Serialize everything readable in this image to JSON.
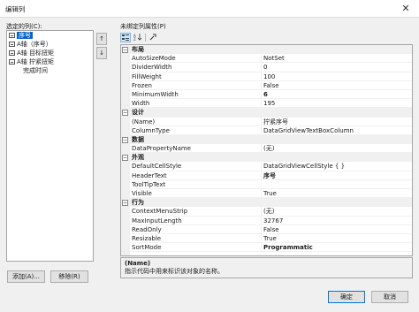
{
  "window": {
    "title": "编辑列",
    "close_glyph": "✕"
  },
  "left_panel": {
    "label": "选定的列(C):",
    "columns": [
      {
        "text": "序号",
        "selected": true,
        "icon": true
      },
      {
        "text": "A轴（序号）",
        "selected": false,
        "icon": true
      },
      {
        "text": "A轴 目标扭矩",
        "selected": false,
        "icon": true
      },
      {
        "text": "A轴 拧紧扭矩",
        "selected": false,
        "icon": true
      },
      {
        "text": "完成时间",
        "selected": false,
        "icon": false
      }
    ],
    "move_up_glyph": "↑",
    "move_down_glyph": "↓",
    "add_button": "添加(A)...",
    "remove_button": "移除(R)"
  },
  "right_panel": {
    "label": "未绑定列属性(P)",
    "toolbar": {
      "categorized_icon": "categorized-icon",
      "alphabetical_icon": "alphabetical-icon",
      "property_pages_icon": "property-pages-icon"
    },
    "rows": [
      {
        "type": "category",
        "name": "布局"
      },
      {
        "type": "property",
        "name": "AutoSizeMode",
        "value": "NotSet",
        "bold": false
      },
      {
        "type": "property",
        "name": "DividerWidth",
        "value": "0",
        "bold": false
      },
      {
        "type": "property",
        "name": "FillWeight",
        "value": "100",
        "bold": false
      },
      {
        "type": "property",
        "name": "Frozen",
        "value": "False",
        "bold": false
      },
      {
        "type": "property",
        "name": "MinimumWidth",
        "value": "6",
        "bold": true
      },
      {
        "type": "property",
        "name": "Width",
        "value": "195",
        "bold": false
      },
      {
        "type": "category",
        "name": "设计"
      },
      {
        "type": "property",
        "name": "(Name)",
        "value": "拧紧序号",
        "bold": false
      },
      {
        "type": "property",
        "name": "ColumnType",
        "value": "DataGridViewTextBoxColumn",
        "bold": false
      },
      {
        "type": "category",
        "name": "数据"
      },
      {
        "type": "property",
        "name": "DataPropertyName",
        "value": "(无)",
        "bold": false
      },
      {
        "type": "category",
        "name": "外观"
      },
      {
        "type": "property",
        "name": "DefaultCellStyle",
        "value": "DataGridViewCellStyle { }",
        "bold": false
      },
      {
        "type": "property",
        "name": "HeaderText",
        "value": "序号",
        "bold": true
      },
      {
        "type": "property",
        "name": "ToolTipText",
        "value": "",
        "bold": false
      },
      {
        "type": "property",
        "name": "Visible",
        "value": "True",
        "bold": false
      },
      {
        "type": "category",
        "name": "行为"
      },
      {
        "type": "property",
        "name": "ContextMenuStrip",
        "value": "(无)",
        "bold": false
      },
      {
        "type": "property",
        "name": "MaxInputLength",
        "value": "32767",
        "bold": false
      },
      {
        "type": "property",
        "name": "ReadOnly",
        "value": "False",
        "bold": false
      },
      {
        "type": "property",
        "name": "Resizable",
        "value": "True",
        "bold": false
      },
      {
        "type": "property",
        "name": "SortMode",
        "value": "Programmatic",
        "bold": true
      }
    ],
    "description": {
      "title": "(Name)",
      "text": "指示代码中用来标识该对象的名称。"
    }
  },
  "footer": {
    "ok_button": "确定",
    "cancel_button": "取消"
  },
  "colors": {
    "selection": "#0a64c8",
    "category_bg": "#f0f0f0",
    "accent_border": "#0078d7"
  }
}
